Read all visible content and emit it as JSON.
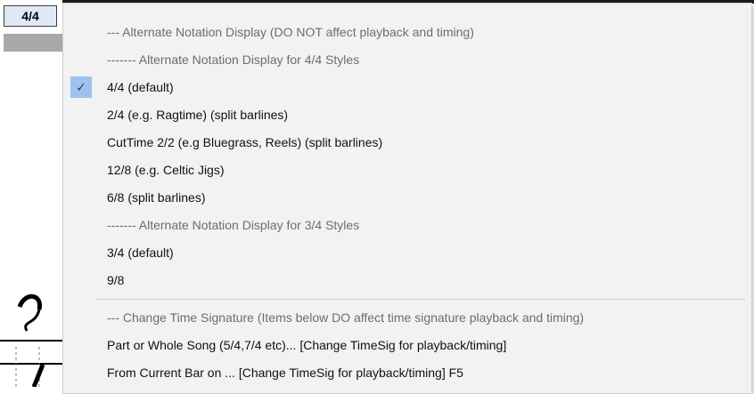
{
  "app": {
    "time_signature": "4/4"
  },
  "menu": {
    "items": [
      {
        "label": "--- Alternate Notation Display (DO NOT affect playback and timing)",
        "disabled": true
      },
      {
        "label": "------- Alternate Notation Display for 4/4 Styles",
        "disabled": true
      },
      {
        "label": "4/4 (default)",
        "checked": true
      },
      {
        "label": "2/4 (e.g. Ragtime) (split barlines)"
      },
      {
        "label": "CutTime 2/2 (e.g Bluegrass, Reels) (split barlines)"
      },
      {
        "label": "12/8 (e.g. Celtic Jigs)"
      },
      {
        "label": "6/8 (split barlines)"
      },
      {
        "label": "------- Alternate Notation Display for 3/4 Styles",
        "disabled": true
      },
      {
        "label": "3/4 (default)"
      },
      {
        "label": "9/8"
      },
      {
        "label": "--- Change Time Signature (Items below DO affect time signature playback and timing)",
        "disabled": true
      },
      {
        "label": "Part or Whole Song (5/4,7/4 etc)... [Change TimeSig for playback/timing]"
      },
      {
        "label": "From Current Bar on ... [Change TimeSig for playback/timing] F5"
      }
    ],
    "check_glyph": "✓"
  },
  "colors": {
    "menu_bg": "#f2f2f2",
    "check_highlight": "#9ec2ef",
    "disabled_text": "#6d6d6d"
  }
}
